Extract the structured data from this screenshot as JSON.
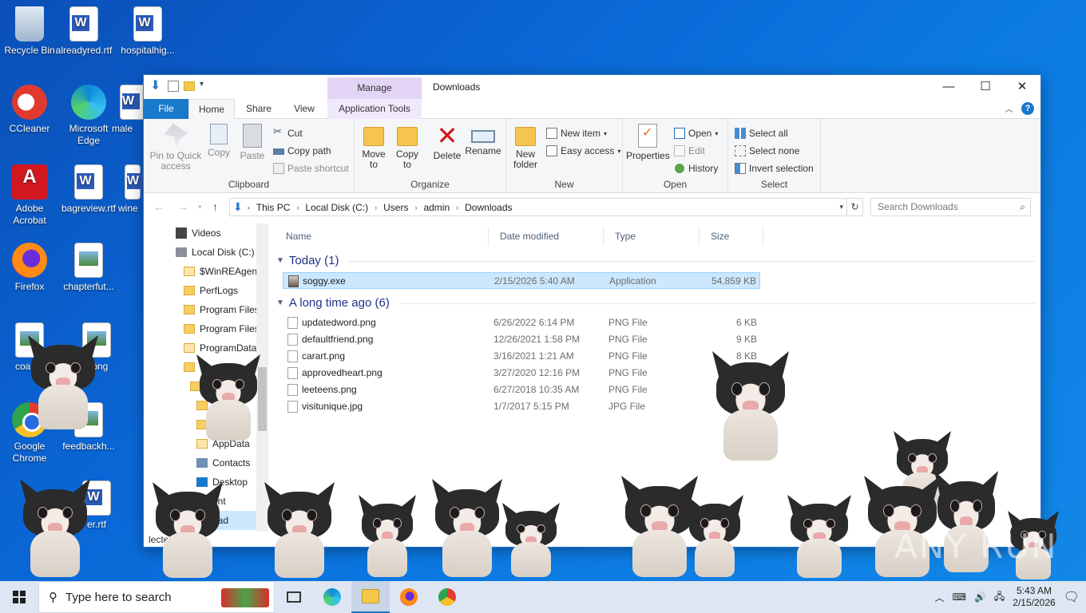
{
  "desktop": {
    "icons": [
      {
        "label": "Recycle Bin",
        "icon": "recycle-bin-icon"
      },
      {
        "label": "alreadyred.rtf",
        "icon": "word-doc-icon"
      },
      {
        "label": "hospitalhig...",
        "icon": "word-doc-icon"
      },
      {
        "label": "CCleaner",
        "icon": "ccleaner-icon"
      },
      {
        "label": "Microsoft Edge",
        "icon": "edge-icon"
      },
      {
        "label": "male",
        "icon": "word-doc-icon"
      },
      {
        "label": "Adobe Acrobat",
        "icon": "acrobat-icon"
      },
      {
        "label": "bagreview.rtf",
        "icon": "word-doc-icon"
      },
      {
        "label": "wine",
        "icon": "word-doc-icon"
      },
      {
        "label": "Firefox",
        "icon": "firefox-icon"
      },
      {
        "label": "chapterfut...",
        "icon": "image-file-icon"
      },
      {
        "label": "coauth",
        "icon": "image-file-icon"
      },
      {
        "label": "il.png",
        "icon": "image-file-icon"
      },
      {
        "label": "Google Chrome",
        "icon": "chrome-icon"
      },
      {
        "label": "feedbackh...",
        "icon": "image-file-icon"
      },
      {
        "label": "er.rtf",
        "icon": "word-doc-icon"
      }
    ]
  },
  "window": {
    "title": "Downloads",
    "manage_tab": "Manage",
    "tabs": {
      "file": "File",
      "home": "Home",
      "share": "Share",
      "view": "View",
      "app_tools": "Application Tools"
    },
    "ribbon": {
      "clipboard": {
        "label": "Clipboard",
        "pin": "Pin to Quick access",
        "copy": "Copy",
        "paste": "Paste",
        "cut": "Cut",
        "copy_path": "Copy path",
        "paste_shortcut": "Paste shortcut"
      },
      "organize": {
        "label": "Organize",
        "move_to": "Move to",
        "copy_to": "Copy to",
        "delete": "Delete",
        "rename": "Rename"
      },
      "new": {
        "label": "New",
        "new_folder": "New folder",
        "new_item": "New item",
        "easy_access": "Easy access"
      },
      "open": {
        "label": "Open",
        "properties": "Properties",
        "open": "Open",
        "edit": "Edit",
        "history": "History"
      },
      "select": {
        "label": "Select",
        "select_all": "Select all",
        "select_none": "Select none",
        "invert": "Invert selection"
      }
    },
    "address": {
      "crumbs": [
        "This PC",
        "Local Disk (C:)",
        "Users",
        "admin",
        "Downloads"
      ],
      "search_placeholder": "Search Downloads"
    },
    "nav": [
      {
        "label": "Videos",
        "icon": "videos-icon"
      },
      {
        "label": "Local Disk (C:)",
        "icon": "drive-icon"
      },
      {
        "label": "$WinREAgent",
        "icon": "folder-icon"
      },
      {
        "label": "PerfLogs",
        "icon": "folder-icon"
      },
      {
        "label": "Program Files",
        "icon": "folder-icon"
      },
      {
        "label": "Program Files",
        "icon": "folder-icon"
      },
      {
        "label": "ProgramData",
        "icon": "folder-icon"
      },
      {
        "label": "Users",
        "icon": "folder-icon"
      },
      {
        "label": "",
        "icon": "folder-icon"
      },
      {
        "label": "",
        "icon": "folder-icon"
      },
      {
        "label": "ects",
        "icon": "folder-icon"
      },
      {
        "label": "AppData",
        "icon": "folder-icon"
      },
      {
        "label": "Contacts",
        "icon": "contacts-icon"
      },
      {
        "label": "Desktop",
        "icon": "desktop-folder-icon"
      },
      {
        "label": "ent",
        "icon": "folder-icon"
      },
      {
        "label": "oad",
        "icon": "folder-icon"
      }
    ],
    "status": "lected",
    "columns": {
      "name": "Name",
      "date": "Date modified",
      "type": "Type",
      "size": "Size"
    },
    "groups": [
      {
        "title": "Today (1)",
        "files": [
          {
            "name": "soggy.exe",
            "date": "2/15/2026 5:40 AM",
            "type": "Application",
            "size": "54,859 KB",
            "selected": true
          }
        ]
      },
      {
        "title": "A long time ago (6)",
        "files": [
          {
            "name": "updatedword.png",
            "date": "6/26/2022 6:14 PM",
            "type": "PNG File",
            "size": "6 KB"
          },
          {
            "name": "defaultfriend.png",
            "date": "12/26/2021 1:58 PM",
            "type": "PNG File",
            "size": "9 KB"
          },
          {
            "name": "carart.png",
            "date": "3/16/2021 1:21 AM",
            "type": "PNG File",
            "size": "8 KB"
          },
          {
            "name": "approvedheart.png",
            "date": "3/27/2020 12:16 PM",
            "type": "PNG File",
            "size": ""
          },
          {
            "name": "leeteens.png",
            "date": "6/27/2018 10:35 AM",
            "type": "PNG File",
            "size": ""
          },
          {
            "name": "visitunique.jpg",
            "date": "1/7/2017 5:15 PM",
            "type": "JPG File",
            "size": ""
          }
        ]
      }
    ]
  },
  "taskbar": {
    "search_placeholder": "Type here to search",
    "time": "5:43 AM",
    "date": "2/15/2026"
  },
  "watermark": "ANY RUN"
}
